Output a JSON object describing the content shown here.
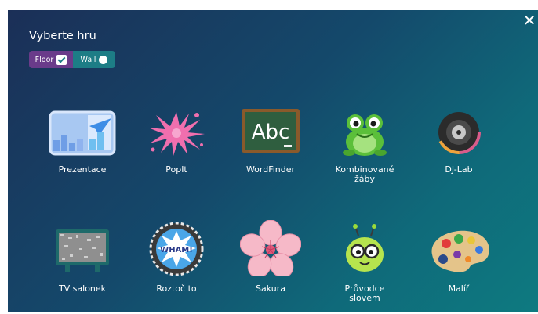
{
  "header": {
    "title": "Vyberte hru",
    "close_icon": "close-icon"
  },
  "mode_toggle": {
    "floor_label": "Floor",
    "wall_label": "Wall",
    "selected": "Floor"
  },
  "games": {
    "row1": [
      {
        "label": "Prezentace",
        "icon": "presentation-icon"
      },
      {
        "label": "PopIt",
        "icon": "splash-icon"
      },
      {
        "label": "WordFinder",
        "icon": "chalkboard-abc-icon",
        "icon_text": "Abc"
      },
      {
        "label": "Kombinované\nžáby",
        "icon": "frog-icon"
      },
      {
        "label": "DJ-Lab",
        "icon": "dj-disc-icon"
      }
    ],
    "row2": [
      {
        "label": "TV salonek",
        "icon": "tv-icon"
      },
      {
        "label": "Roztoč to",
        "icon": "wham-badge-icon",
        "icon_text": "WHAM!"
      },
      {
        "label": "Sakura",
        "icon": "sakura-flower-icon"
      },
      {
        "label": "Průvodce\nslovem",
        "icon": "bug-with-glasses-icon"
      },
      {
        "label": "Malíř",
        "icon": "paint-palette-icon"
      }
    ]
  }
}
